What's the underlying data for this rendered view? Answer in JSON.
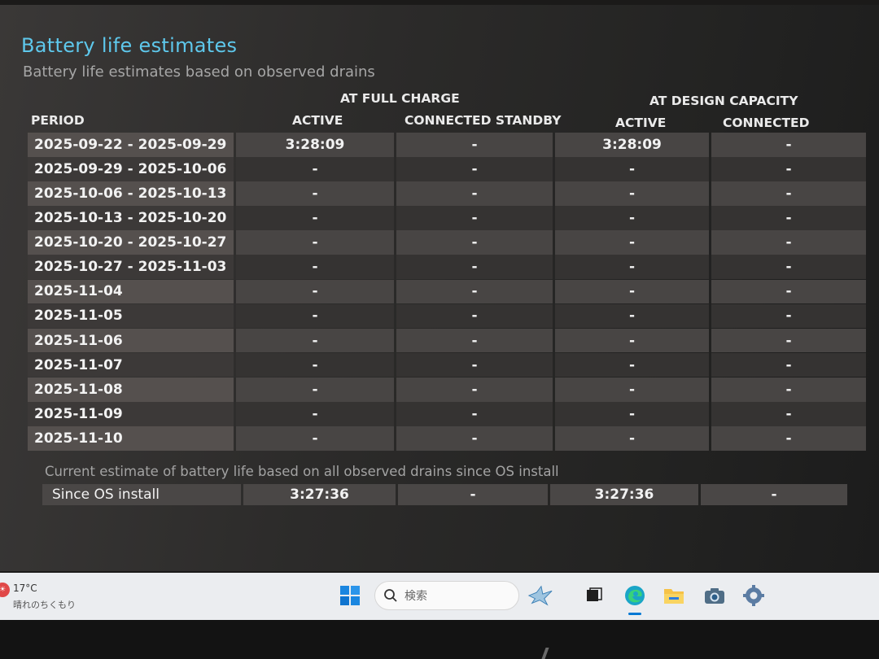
{
  "page": {
    "title": "Battery life estimates",
    "subtitle": "Battery life estimates based on observed drains"
  },
  "headers": {
    "full_charge": "AT FULL CHARGE",
    "design_capacity": "AT DESIGN CAPACITY",
    "period": "PERIOD",
    "active": "ACTIVE",
    "connected_standby": "CONNECTED STANDBY"
  },
  "rows": [
    {
      "period": "2025-09-22 - 2025-09-29",
      "fc_active": "3:28:09",
      "fc_standby": "-",
      "dc_active": "3:28:09",
      "dc_standby": "-"
    },
    {
      "period": "2025-09-29 - 2025-10-06",
      "fc_active": "-",
      "fc_standby": "-",
      "dc_active": "-",
      "dc_standby": "-"
    },
    {
      "period": "2025-10-06 - 2025-10-13",
      "fc_active": "-",
      "fc_standby": "-",
      "dc_active": "-",
      "dc_standby": "-"
    },
    {
      "period": "2025-10-13 - 2025-10-20",
      "fc_active": "-",
      "fc_standby": "-",
      "dc_active": "-",
      "dc_standby": "-"
    },
    {
      "period": "2025-10-20 - 2025-10-27",
      "fc_active": "-",
      "fc_standby": "-",
      "dc_active": "-",
      "dc_standby": "-"
    },
    {
      "period": "2025-10-27 - 2025-11-03",
      "fc_active": "-",
      "fc_standby": "-",
      "dc_active": "-",
      "dc_standby": "-"
    },
    {
      "period": "2025-11-04",
      "fc_active": "-",
      "fc_standby": "-",
      "dc_active": "-",
      "dc_standby": "-"
    },
    {
      "period": "2025-11-05",
      "fc_active": "-",
      "fc_standby": "-",
      "dc_active": "-",
      "dc_standby": "-"
    },
    {
      "period": "2025-11-06",
      "fc_active": "-",
      "fc_standby": "-",
      "dc_active": "-",
      "dc_standby": "-"
    },
    {
      "period": "2025-11-07",
      "fc_active": "-",
      "fc_standby": "-",
      "dc_active": "-",
      "dc_standby": "-"
    },
    {
      "period": "2025-11-08",
      "fc_active": "-",
      "fc_standby": "-",
      "dc_active": "-",
      "dc_standby": "-"
    },
    {
      "period": "2025-11-09",
      "fc_active": "-",
      "fc_standby": "-",
      "dc_active": "-",
      "dc_standby": "-"
    },
    {
      "period": "2025-11-10",
      "fc_active": "-",
      "fc_standby": "-",
      "dc_active": "-",
      "dc_standby": "-"
    }
  ],
  "since_install": {
    "note": "Current estimate of battery life based on all observed drains since OS install",
    "label": "Since OS install",
    "fc_active": "3:27:36",
    "fc_standby": "-",
    "dc_active": "3:27:36",
    "dc_standby": "-"
  },
  "taskbar": {
    "weather_temp": "17°C",
    "weather_desc": "晴れのちくもり",
    "search_placeholder": "検索",
    "icons": [
      "windows-start-icon",
      "search-icon",
      "crane-widget-icon",
      "task-view-icon",
      "edge-icon",
      "file-explorer-icon",
      "camera-icon",
      "settings-icon"
    ]
  },
  "colors": {
    "title": "#5ec8ec",
    "accent_blue": "#0078d4"
  }
}
